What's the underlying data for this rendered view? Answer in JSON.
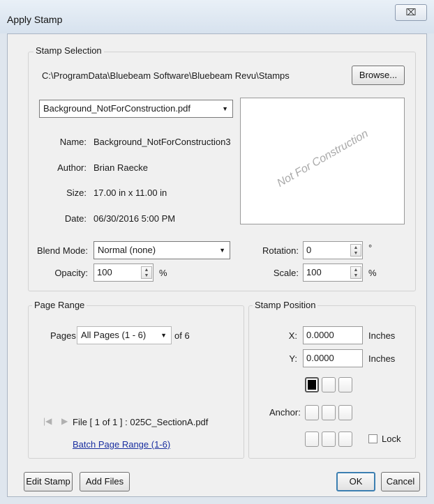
{
  "window": {
    "title": "Apply Stamp",
    "close_glyph": "⌧"
  },
  "stamp_selection": {
    "legend": "Stamp Selection",
    "path": "C:\\ProgramData\\Bluebeam Software\\Bluebeam Revu\\Stamps",
    "browse_label": "Browse...",
    "stamp_file": "Background_NotForConstruction.pdf",
    "name_label": "Name:",
    "name_value": "Background_NotForConstruction3",
    "author_label": "Author:",
    "author_value": "Brian Raecke",
    "size_label": "Size:",
    "size_value": "17.00 in x 11.00 in",
    "date_label": "Date:",
    "date_value": "06/30/2016  5:00 PM",
    "preview_text": "Not For Construction",
    "blend_mode_label": "Blend Mode:",
    "blend_mode_value": "Normal (none)",
    "opacity_label": "Opacity:",
    "opacity_value": "100",
    "opacity_unit": "%",
    "rotation_label": "Rotation:",
    "rotation_value": "0",
    "rotation_unit": "°",
    "scale_label": "Scale:",
    "scale_value": "100",
    "scale_unit": "%"
  },
  "page_range": {
    "legend": "Page Range",
    "pages_label": "Pages",
    "pages_value": "All Pages (1 - 6)",
    "of_text": "of 6",
    "file_text": "File [ 1 of 1 ] :  025C_SectionA.pdf",
    "batch_link": "Batch Page Range (1-6)"
  },
  "stamp_position": {
    "legend": "Stamp Position",
    "x_label": "X:",
    "x_value": "0.0000",
    "x_unit": "Inches",
    "y_label": "Y:",
    "y_value": "0.0000",
    "y_unit": "Inches",
    "anchor_label": "Anchor:",
    "anchor_selected": "top-left",
    "lock_label": "Lock"
  },
  "footer": {
    "edit_stamp": "Edit Stamp",
    "add_files": "Add Files",
    "ok": "OK",
    "cancel": "Cancel"
  }
}
